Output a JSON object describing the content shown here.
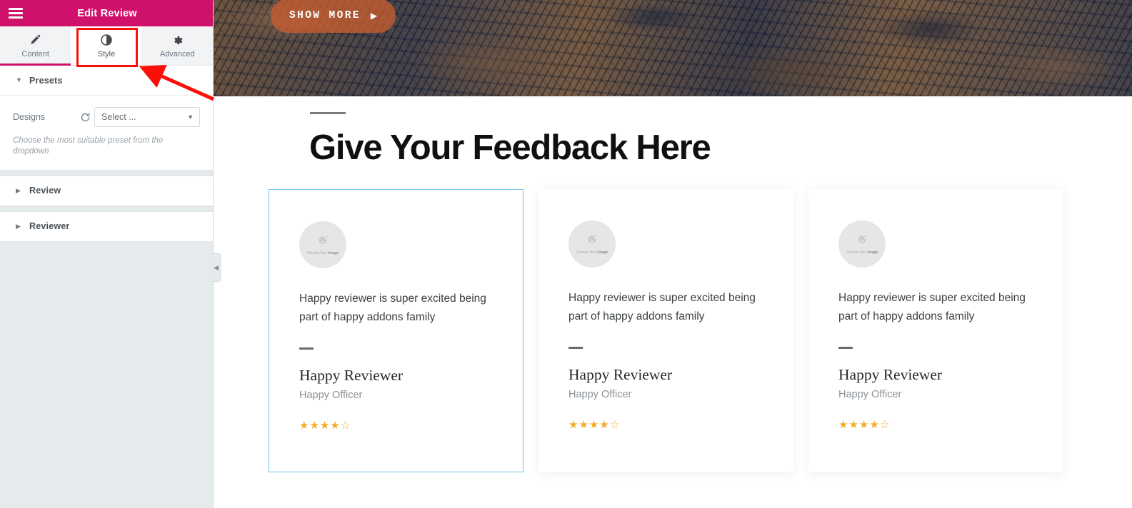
{
  "panel": {
    "title": "Edit Review",
    "menu_icon": "hamburger-icon",
    "apps_icon": "grid-apps-icon",
    "tabs": [
      {
        "label": "Content",
        "icon": "pencil-icon",
        "active": false
      },
      {
        "label": "Style",
        "icon": "contrast-circle-icon",
        "active": true
      },
      {
        "label": "Advanced",
        "icon": "gear-icon",
        "active": false
      }
    ],
    "sections": [
      {
        "label": "Presets",
        "expanded": true
      },
      {
        "label": "Review",
        "expanded": false
      },
      {
        "label": "Reviewer",
        "expanded": false
      }
    ],
    "presets": {
      "field_label": "Designs",
      "refresh_icon": "refresh-icon",
      "select_value": "Select ...",
      "select_placeholder": "Select ...",
      "help_text": "Choose the most suitable preset from the dropdown"
    },
    "collapse_handle_icon": "chevron-left-icon"
  },
  "canvas": {
    "hero": {
      "button_label": "SHOW MORE",
      "button_arrow": "play-triangle-icon",
      "button_color": "#c65e30"
    },
    "section": {
      "divider": "title-rule",
      "title": "Give Your Feedback Here"
    },
    "cards": [
      {
        "selected": true,
        "avatar_caption_prefix": "Choose Your ",
        "avatar_caption_bold": "Image",
        "avatar_icon": "image-placeholder-icon",
        "review_text": "Happy reviewer is super excited being part of happy addons family",
        "name": "Happy Reviewer",
        "role": "Happy Officer",
        "rating": 4,
        "rating_max": 5
      },
      {
        "selected": false,
        "avatar_caption_prefix": "Choose Your ",
        "avatar_caption_bold": "Image",
        "avatar_icon": "image-placeholder-icon",
        "review_text": "Happy reviewer is super excited being part of happy addons family",
        "name": "Happy Reviewer",
        "role": "Happy Officer",
        "rating": 4,
        "rating_max": 5
      },
      {
        "selected": false,
        "avatar_caption_prefix": "Choose Your ",
        "avatar_caption_bold": "Image",
        "avatar_icon": "image-placeholder-icon",
        "review_text": "Happy reviewer is super excited being part of happy addons family",
        "name": "Happy Reviewer",
        "role": "Happy Officer",
        "rating": 4,
        "rating_max": 5
      }
    ]
  },
  "annotation": {
    "highlight_target": "Style",
    "color": "#fa0f09"
  },
  "colors": {
    "brand_pink": "#d0116b",
    "selected_border": "#6cc3e8",
    "star_gold": "#f3ab27",
    "sidebar_bg": "#e5eaec"
  }
}
